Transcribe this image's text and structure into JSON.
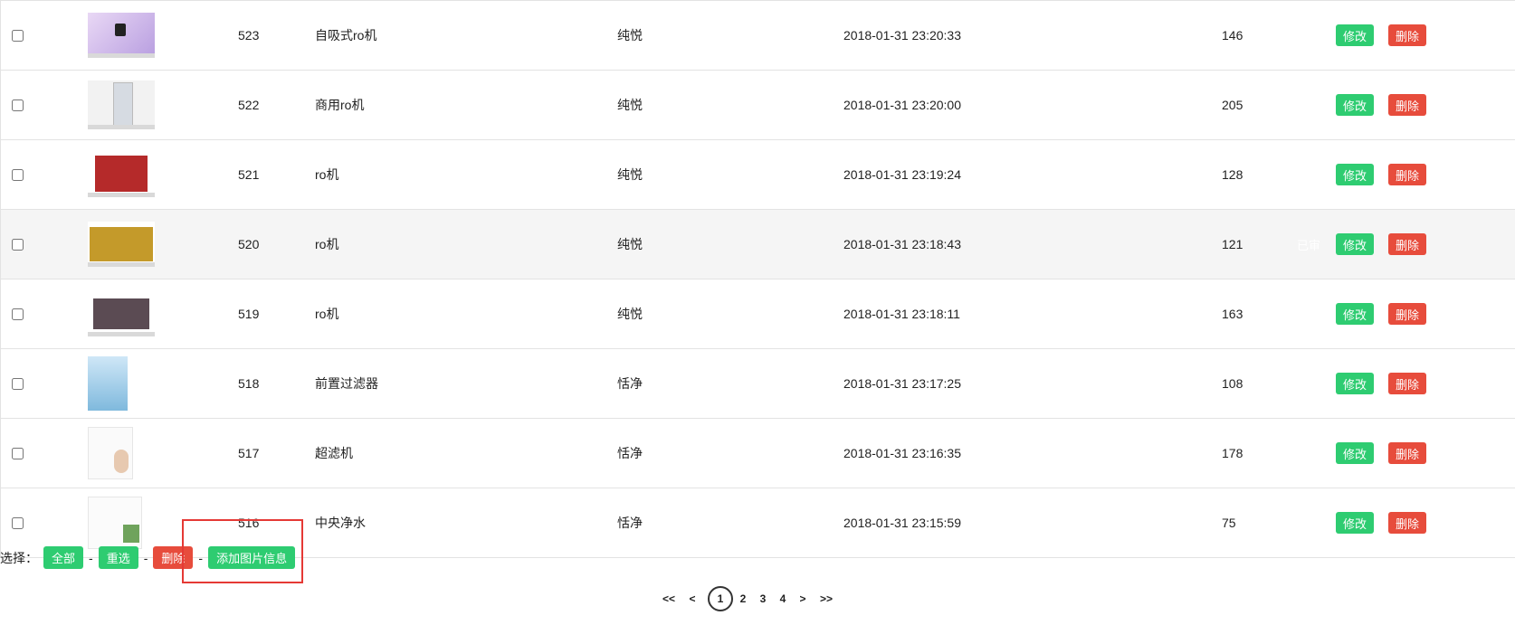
{
  "rows": [
    {
      "id": "523",
      "name": "自吸式ro机",
      "brand": "纯悦",
      "time": "2018-01-31 23:20:33",
      "count": "146",
      "edit": "修改",
      "del": "删除"
    },
    {
      "id": "522",
      "name": "商用ro机",
      "brand": "纯悦",
      "time": "2018-01-31 23:20:00",
      "count": "205",
      "edit": "修改",
      "del": "删除"
    },
    {
      "id": "521",
      "name": "ro机",
      "brand": "纯悦",
      "time": "2018-01-31 23:19:24",
      "count": "128",
      "edit": "修改",
      "del": "删除"
    },
    {
      "id": "520",
      "name": "ro机",
      "brand": "纯悦",
      "time": "2018-01-31 23:18:43",
      "count": "121",
      "edit": "修改",
      "del": "删除",
      "status": "已审"
    },
    {
      "id": "519",
      "name": "ro机",
      "brand": "纯悦",
      "time": "2018-01-31 23:18:11",
      "count": "163",
      "edit": "修改",
      "del": "删除"
    },
    {
      "id": "518",
      "name": "前置过滤器",
      "brand": "恬净",
      "time": "2018-01-31 23:17:25",
      "count": "108",
      "edit": "修改",
      "del": "删除"
    },
    {
      "id": "517",
      "name": "超滤机",
      "brand": "恬净",
      "time": "2018-01-31 23:16:35",
      "count": "178",
      "edit": "修改",
      "del": "删除"
    },
    {
      "id": "516",
      "name": "中央净水",
      "brand": "恬净",
      "time": "2018-01-31 23:15:59",
      "count": "75",
      "edit": "修改",
      "del": "删除"
    }
  ],
  "footer": {
    "select_label": "选择：",
    "all": "全部",
    "reset": "重选",
    "delete": "删除",
    "add_image": "添加图片信息",
    "sep": "-"
  },
  "pagination": {
    "first": "<<",
    "prev": "<",
    "pages": [
      "1",
      "2",
      "3",
      "4"
    ],
    "current": "1",
    "next": ">",
    "last": ">>"
  },
  "colors": {
    "green": "#2ecc71",
    "red": "#e74c3c",
    "highlight": "#e53935"
  }
}
